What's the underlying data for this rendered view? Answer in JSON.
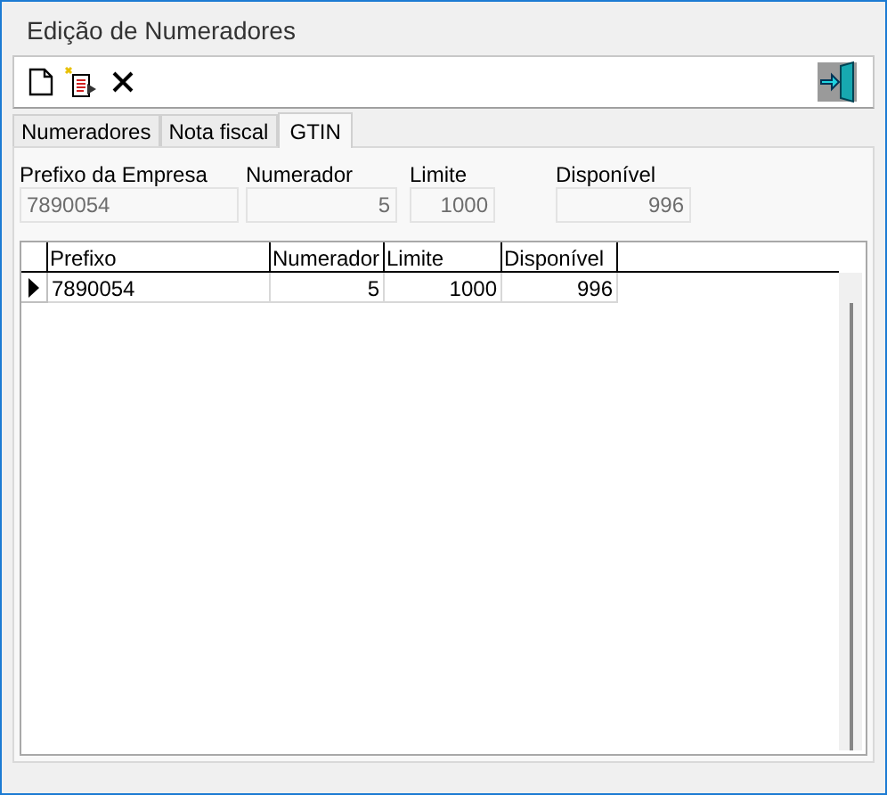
{
  "window": {
    "title": "Edição de Numeradores"
  },
  "tabs": [
    {
      "label": "Numeradores",
      "selected": false
    },
    {
      "label": "Nota fiscal",
      "selected": false
    },
    {
      "label": "GTIN",
      "selected": true
    }
  ],
  "fields": [
    {
      "label": "Prefixo da Empresa",
      "value": "7890054",
      "kind": "text"
    },
    {
      "label": "Numerador",
      "value": "5",
      "kind": "number"
    },
    {
      "label": "Limite",
      "value": "1000",
      "kind": "number"
    },
    {
      "label": "Disponível",
      "value": "996",
      "kind": "number"
    }
  ],
  "table": {
    "columns": [
      {
        "label": "Prefixo",
        "kind": "text"
      },
      {
        "label": "Numerador",
        "kind": "number"
      },
      {
        "label": "Limite",
        "kind": "number"
      },
      {
        "label": "Disponível",
        "kind": "number"
      }
    ],
    "rows": [
      {
        "selected": true,
        "cells": [
          "7890054",
          "5",
          "1000",
          "996"
        ]
      }
    ]
  }
}
